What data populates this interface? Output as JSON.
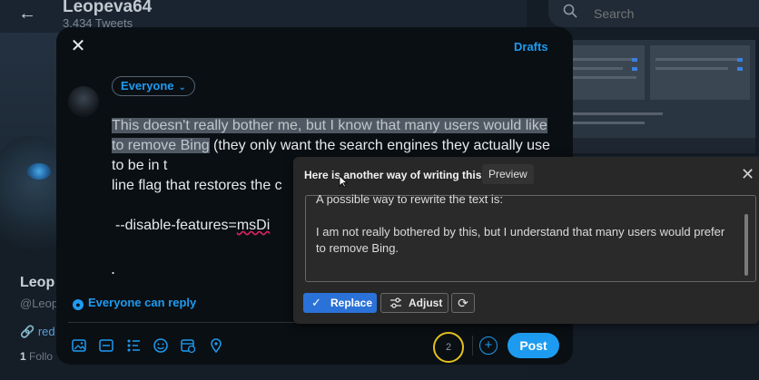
{
  "profile": {
    "name": "Leopeva64",
    "tweets": "3,434 Tweets",
    "left_name": "Leop",
    "left_handle": "@Leop",
    "left_link": "red",
    "left_follow_count": "1",
    "left_follow_label": "Follo"
  },
  "search": {
    "placeholder": "Search"
  },
  "composer": {
    "drafts_label": "Drafts",
    "audience_label": "Everyone",
    "text_selected": "This doesn't really bother me, but I know that many users would like to remove Bing",
    "text_rest": " (they only want the search engines they actually use to be in t",
    "text_line3": "line flag that restores the c",
    "flag_prefix": "--disable-features=",
    "flag_word": "msDi",
    "dot": ".",
    "reply_setting": "Everyone can reply",
    "char_count": "2",
    "add_label": "+",
    "post_label": "Post"
  },
  "rewrite": {
    "title": "Here is another way of writing this",
    "preview_label": "Preview",
    "intro": "A possible way to rewrite the text is:",
    "suggestion": "I am not really bothered by this, but I understand that many users would prefer to remove Bing.",
    "replace_label": "Replace",
    "adjust_label": "Adjust"
  },
  "icons": {
    "back": "back-arrow-icon",
    "close": "close-icon",
    "search": "search-icon",
    "toolbar": [
      "image-icon",
      "gif-icon",
      "poll-icon",
      "emoji-icon",
      "schedule-icon",
      "location-icon"
    ]
  },
  "colors": {
    "accent": "#1d9bf0",
    "counter_ring": "#e3c11d",
    "replace_button": "#2b72d8"
  }
}
